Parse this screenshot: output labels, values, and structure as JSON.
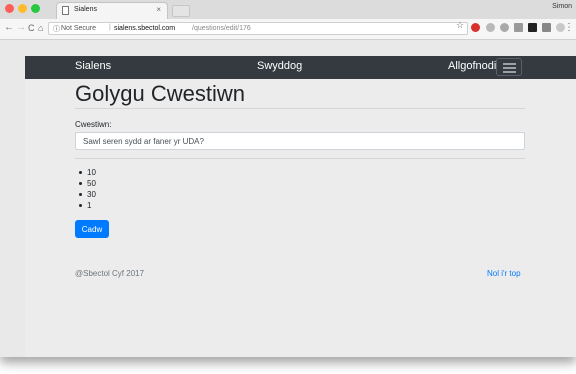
{
  "browser": {
    "tab_title": "Sialens",
    "tab_close": "×",
    "profile_name": "Simon",
    "back_glyph": "←",
    "forward_glyph": "→",
    "reload_glyph": "C",
    "home_glyph": "⌂",
    "security_icon": "ⓘ",
    "security_label": "Not Secure",
    "separator": "|",
    "url_domain": "sialens.sbectol.com",
    "url_path": "/questions/edit/176",
    "star_glyph": "☆",
    "menu_glyph": "⋮",
    "colors": {
      "close": "#fc5f57",
      "minimize": "#fdbc2e",
      "maximize": "#27c841"
    }
  },
  "navbar": {
    "brand": "Sialens",
    "center": "Swyddog",
    "right": "Allgofnodi",
    "background": "#343a40"
  },
  "page": {
    "heading": "Golygu Cwestiwn",
    "question_label": "Cwestiwn:",
    "question_value": "Sawl seren sydd ar faner yr UDA?",
    "answers": [
      "10",
      "50",
      "30",
      "1"
    ],
    "save_label": "Cadw",
    "accent_color": "#007bff"
  },
  "footer": {
    "copyright": "@Sbectol Cyf 2017",
    "back_to_top": "Nol i'r top"
  }
}
